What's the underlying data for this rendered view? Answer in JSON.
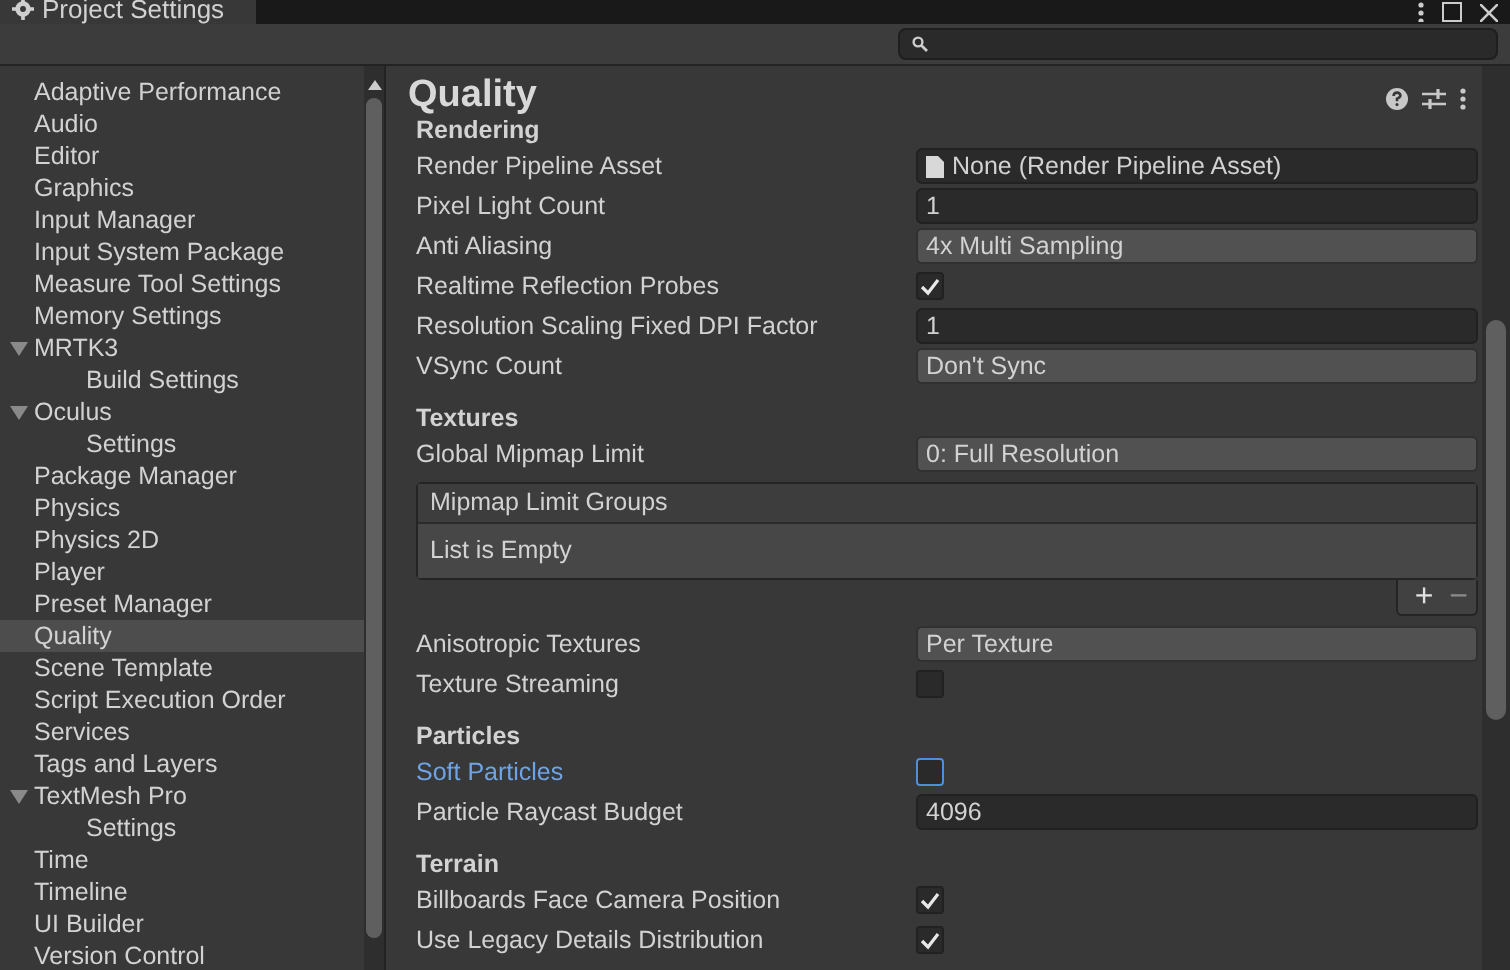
{
  "window": {
    "tab_title": "Project Settings"
  },
  "sidebar": {
    "items": [
      {
        "label": "Adaptive Performance",
        "selected": false
      },
      {
        "label": "Audio",
        "selected": false
      },
      {
        "label": "Editor",
        "selected": false
      },
      {
        "label": "Graphics",
        "selected": false
      },
      {
        "label": "Input Manager",
        "selected": false
      },
      {
        "label": "Input System Package",
        "selected": false
      },
      {
        "label": "Measure Tool Settings",
        "selected": false
      },
      {
        "label": "Memory Settings",
        "selected": false
      },
      {
        "label": "MRTK3",
        "selected": false,
        "expanded": true,
        "children": [
          {
            "label": "Build Settings",
            "selected": false
          }
        ]
      },
      {
        "label": "Oculus",
        "selected": false,
        "expanded": true,
        "children": [
          {
            "label": "Settings",
            "selected": false
          }
        ]
      },
      {
        "label": "Package Manager",
        "selected": false
      },
      {
        "label": "Physics",
        "selected": false
      },
      {
        "label": "Physics 2D",
        "selected": false
      },
      {
        "label": "Player",
        "selected": false
      },
      {
        "label": "Preset Manager",
        "selected": false
      },
      {
        "label": "Quality",
        "selected": true
      },
      {
        "label": "Scene Template",
        "selected": false
      },
      {
        "label": "Script Execution Order",
        "selected": false
      },
      {
        "label": "Services",
        "selected": false
      },
      {
        "label": "Tags and Layers",
        "selected": false
      },
      {
        "label": "TextMesh Pro",
        "selected": false,
        "expanded": true,
        "children": [
          {
            "label": "Settings",
            "selected": false
          }
        ]
      },
      {
        "label": "Time",
        "selected": false
      },
      {
        "label": "Timeline",
        "selected": false
      },
      {
        "label": "UI Builder",
        "selected": false
      },
      {
        "label": "Version Control",
        "selected": false
      }
    ]
  },
  "panel": {
    "title": "Quality",
    "sections": [
      {
        "title": "Rendering",
        "rows": [
          {
            "kind": "object",
            "label": "Render Pipeline Asset",
            "value": "None (Render Pipeline Asset)"
          },
          {
            "kind": "number",
            "label": "Pixel Light Count",
            "value": "1"
          },
          {
            "kind": "dropdown",
            "label": "Anti Aliasing",
            "value": "4x Multi Sampling"
          },
          {
            "kind": "checkbox",
            "label": "Realtime Reflection Probes",
            "checked": true,
            "focused": false
          },
          {
            "kind": "number",
            "label": "Resolution Scaling Fixed DPI Factor",
            "value": "1"
          },
          {
            "kind": "dropdown",
            "label": "VSync Count",
            "value": "Don't Sync"
          }
        ]
      },
      {
        "title": "Textures",
        "rows": [
          {
            "kind": "dropdown",
            "label": "Global Mipmap Limit",
            "value": "0: Full Resolution"
          },
          {
            "kind": "list",
            "label": "Mipmap Limit Groups",
            "value": "List is Empty",
            "buttons": [
              "+",
              "−"
            ]
          },
          {
            "kind": "dropdown",
            "label": "Anisotropic Textures",
            "value": "Per Texture"
          },
          {
            "kind": "checkbox",
            "label": "Texture Streaming",
            "checked": false,
            "focused": false
          }
        ]
      },
      {
        "title": "Particles",
        "rows": [
          {
            "kind": "checkbox",
            "label": "Soft Particles",
            "checked": false,
            "focused": true
          },
          {
            "kind": "number",
            "label": "Particle Raycast Budget",
            "value": "4096"
          }
        ]
      },
      {
        "title": "Terrain",
        "rows": [
          {
            "kind": "checkbox",
            "label": "Billboards Face Camera Position",
            "checked": true,
            "focused": false
          },
          {
            "kind": "checkbox",
            "label": "Use Legacy Details Distribution",
            "checked": true,
            "focused": false
          }
        ]
      }
    ]
  }
}
